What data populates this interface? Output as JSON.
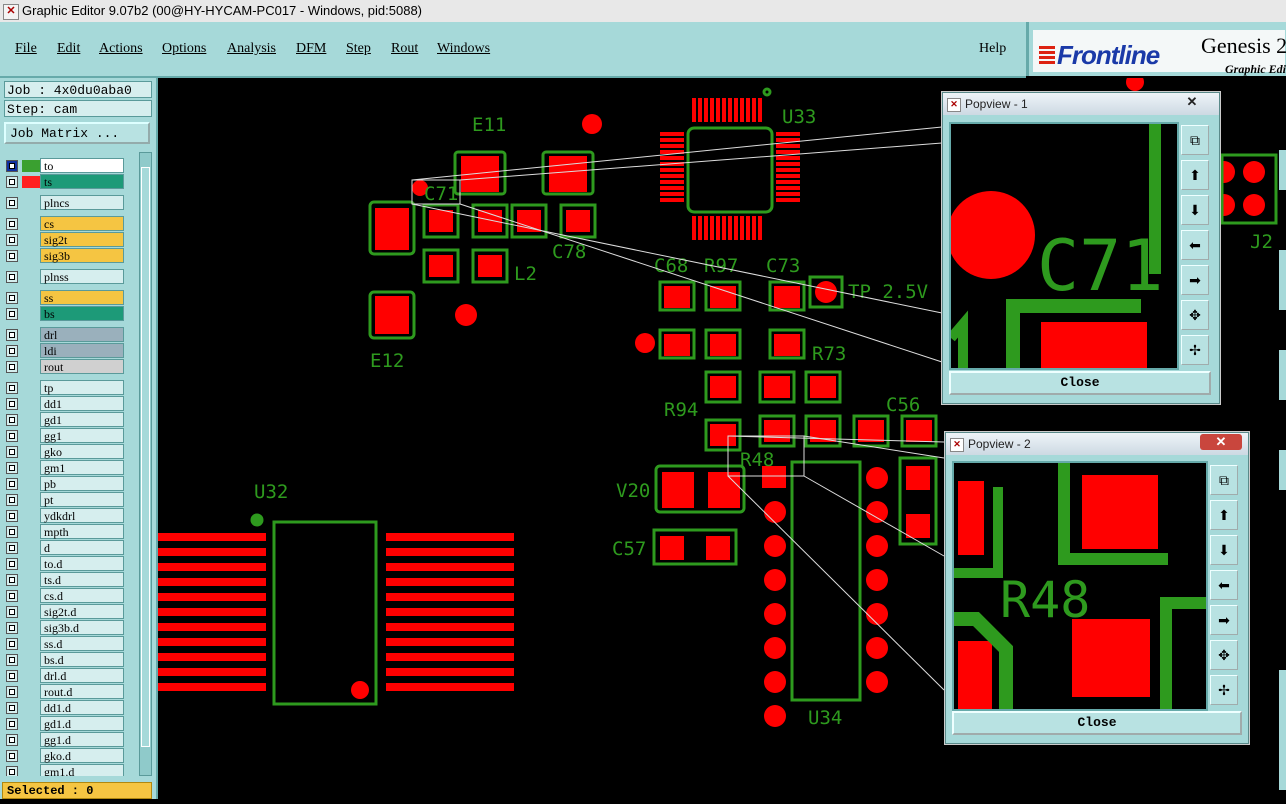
{
  "window": {
    "title": "Graphic Editor 9.07b2 (00@HY-HYCAM-PC017 - Windows, pid:5088)",
    "icon": "x-window-icon"
  },
  "menu": {
    "items": [
      "File",
      "Edit",
      "Actions",
      "Options",
      "Analysis",
      "DFM",
      "Step",
      "Rout",
      "Windows"
    ],
    "help": "Help"
  },
  "logo": {
    "brand": "Frontline",
    "product": "Genesis 2",
    "subtitle": "Graphic Edi"
  },
  "sidebar": {
    "job_label": "Job : 4x0du0aba0",
    "step_label": "Step: cam",
    "job_matrix": "Job Matrix ...",
    "selected": "Selected : 0",
    "layers": [
      {
        "name": "to",
        "bg": "#ffffff",
        "swatch": "#3aa030"
      },
      {
        "name": "ts",
        "bg": "#1d9a78",
        "swatch": "#ff2020"
      },
      {
        "name": "plncs",
        "bg": "#d6eeee",
        "swatch": ""
      },
      {
        "name": "cs",
        "bg": "#f5c542",
        "swatch": ""
      },
      {
        "name": "sig2t",
        "bg": "#f5c542",
        "swatch": ""
      },
      {
        "name": "sig3b",
        "bg": "#f5c542",
        "swatch": ""
      },
      {
        "name": "plnss",
        "bg": "#d6eeee",
        "swatch": ""
      },
      {
        "name": "ss",
        "bg": "#f5c542",
        "swatch": ""
      },
      {
        "name": "bs",
        "bg": "#1d9a78",
        "swatch": ""
      },
      {
        "name": "drl",
        "bg": "#9ab0bc",
        "swatch": ""
      },
      {
        "name": "ldi",
        "bg": "#9ab0bc",
        "swatch": ""
      },
      {
        "name": "rout",
        "bg": "#d0d0d0",
        "swatch": ""
      },
      {
        "name": "tp",
        "bg": "#d6eeee",
        "swatch": ""
      },
      {
        "name": "dd1",
        "bg": "#d6eeee",
        "swatch": ""
      },
      {
        "name": "gd1",
        "bg": "#d6eeee",
        "swatch": ""
      },
      {
        "name": "gg1",
        "bg": "#d6eeee",
        "swatch": ""
      },
      {
        "name": "gko",
        "bg": "#d6eeee",
        "swatch": ""
      },
      {
        "name": "gm1",
        "bg": "#d6eeee",
        "swatch": ""
      },
      {
        "name": "pb",
        "bg": "#d6eeee",
        "swatch": ""
      },
      {
        "name": "pt",
        "bg": "#d6eeee",
        "swatch": ""
      },
      {
        "name": "ydkdrl",
        "bg": "#d6eeee",
        "swatch": ""
      },
      {
        "name": "mpth",
        "bg": "#d6eeee",
        "swatch": ""
      },
      {
        "name": "d",
        "bg": "#d6eeee",
        "swatch": ""
      },
      {
        "name": "to.d",
        "bg": "#d6eeee",
        "swatch": ""
      },
      {
        "name": "ts.d",
        "bg": "#d6eeee",
        "swatch": ""
      },
      {
        "name": "cs.d",
        "bg": "#d6eeee",
        "swatch": ""
      },
      {
        "name": "sig2t.d",
        "bg": "#d6eeee",
        "swatch": ""
      },
      {
        "name": "sig3b.d",
        "bg": "#d6eeee",
        "swatch": ""
      },
      {
        "name": "ss.d",
        "bg": "#d6eeee",
        "swatch": ""
      },
      {
        "name": "bs.d",
        "bg": "#d6eeee",
        "swatch": ""
      },
      {
        "name": "drl.d",
        "bg": "#d6eeee",
        "swatch": ""
      },
      {
        "name": "rout.d",
        "bg": "#d6eeee",
        "swatch": ""
      },
      {
        "name": "dd1.d",
        "bg": "#d6eeee",
        "swatch": ""
      },
      {
        "name": "gd1.d",
        "bg": "#d6eeee",
        "swatch": ""
      },
      {
        "name": "gg1.d",
        "bg": "#d6eeee",
        "swatch": ""
      },
      {
        "name": "gko.d",
        "bg": "#d6eeee",
        "swatch": ""
      },
      {
        "name": "gm1.d",
        "bg": "#d6eeee",
        "swatch": ""
      }
    ]
  },
  "board": {
    "labels": [
      "E11",
      "C71",
      "C78",
      "L2",
      "E12",
      "U33",
      "C68",
      "R97",
      "C73",
      "TP 2.5V",
      "R73",
      "R94",
      "C56",
      "R48",
      "V20",
      "C57",
      "U32",
      "U34",
      "J2"
    ],
    "pad_color": "#ff0000",
    "silk_color": "#2e9a1e"
  },
  "popviews": [
    {
      "title": "Popview - 1",
      "close_label": "Close",
      "zoom_label": "C71"
    },
    {
      "title": "Popview - 2",
      "close_label": "Close",
      "zoom_label": "R48"
    }
  ],
  "popview_tools": [
    "zoom-fit-icon",
    "pan-up-icon",
    "pan-down-icon",
    "pan-left-icon",
    "pan-right-icon",
    "zoom-in-icon",
    "zoom-out-icon"
  ]
}
